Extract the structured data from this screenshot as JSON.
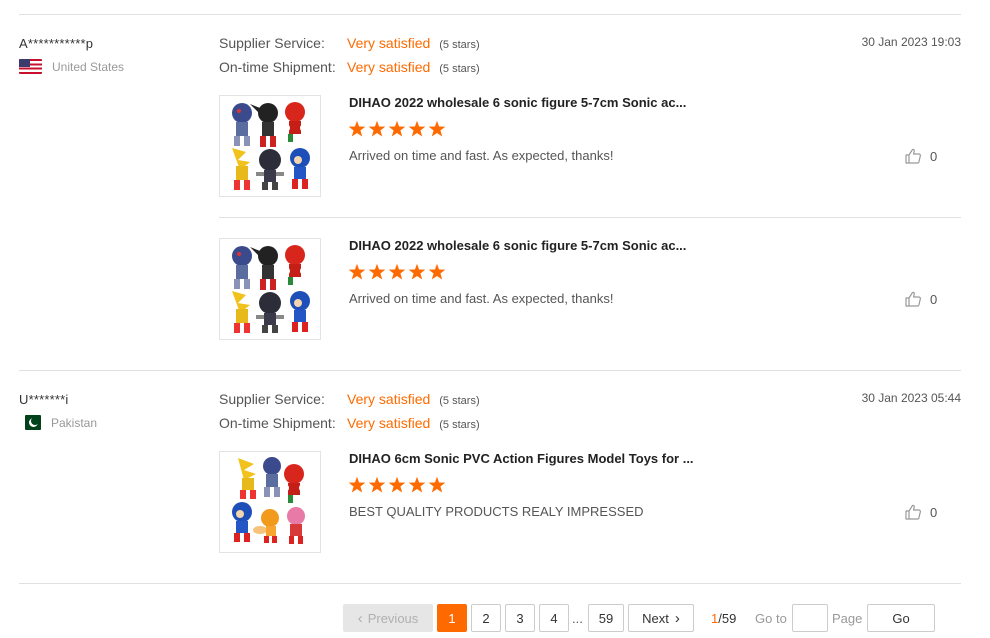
{
  "reviews": [
    {
      "buyer": "A***********p",
      "country": "United States",
      "supplier_service_label": "Supplier Service:",
      "supplier_service_value": "Very satisfied",
      "supplier_service_stars": "(5 stars)",
      "shipment_label": "On-time Shipment:",
      "shipment_value": "Very satisfied",
      "shipment_stars": "(5 stars)",
      "date": "30 Jan 2023 19:03",
      "items": [
        {
          "title": "DIHAO 2022 wholesale 6 sonic figure 5-7cm Sonic ac...",
          "rating": 5,
          "feedback": "Arrived on time and fast. As expected, thanks!",
          "likes": "0"
        },
        {
          "title": "DIHAO 2022 wholesale 6 sonic figure 5-7cm Sonic ac...",
          "rating": 5,
          "feedback": "Arrived on time and fast. As expected, thanks!",
          "likes": "0"
        }
      ]
    },
    {
      "buyer": "U*******i",
      "country": "Pakistan",
      "supplier_service_label": "Supplier Service:",
      "supplier_service_value": "Very satisfied",
      "supplier_service_stars": "(5 stars)",
      "shipment_label": "On-time Shipment:",
      "shipment_value": "Very satisfied",
      "shipment_stars": "(5 stars)",
      "date": "30 Jan 2023 05:44",
      "items": [
        {
          "title": "DIHAO 6cm Sonic PVC Action Figures Model Toys for ...",
          "rating": 5,
          "feedback": "BEST QUALITY PRODUCTS REALY IMPRESSED",
          "likes": "0"
        }
      ]
    }
  ],
  "pagination": {
    "previous_label": "Previous",
    "next_label": "Next",
    "pages": [
      "1",
      "2",
      "3",
      "4"
    ],
    "ellipsis": "...",
    "last_page": "59",
    "current": "1",
    "total_sep": "/59",
    "goto_label": "Go to",
    "page_label": "Page",
    "go_button": "Go",
    "goto_value": ""
  },
  "colors": {
    "accent": "#ff6a00",
    "divider": "#e0e0e0"
  },
  "icons": {
    "like": "thumbs-up-icon",
    "prev": "chevron-left-icon",
    "next": "chevron-right-icon"
  }
}
